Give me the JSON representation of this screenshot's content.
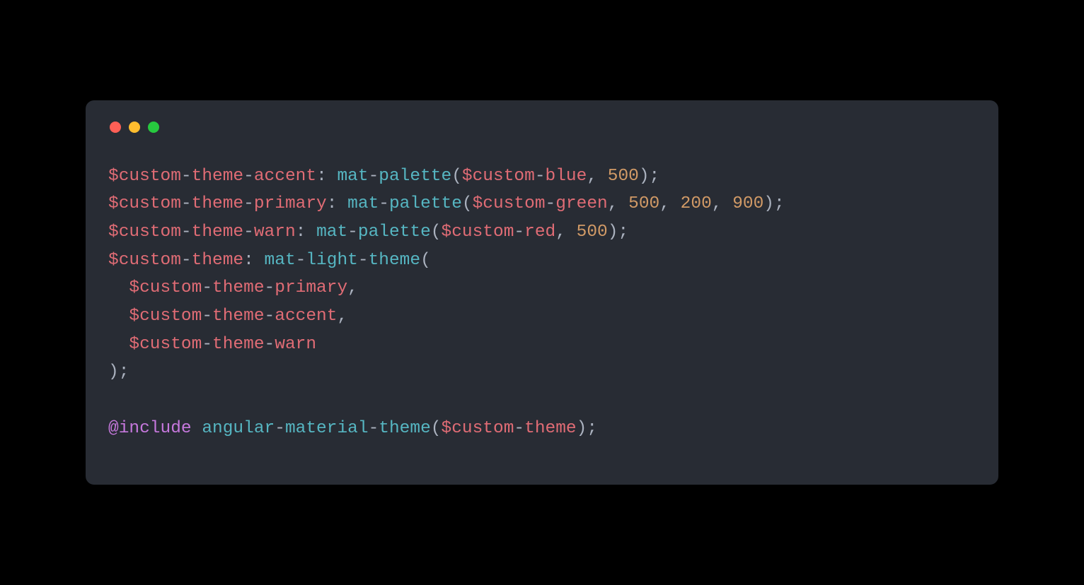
{
  "colors": {
    "traffic_red": "#ff5f56",
    "traffic_yellow": "#ffbd2e",
    "traffic_green": "#27c93f",
    "bg": "#282c34"
  },
  "code": {
    "tokens": [
      [
        {
          "t": "var",
          "v": "$custom"
        },
        {
          "t": "punc",
          "v": "-"
        },
        {
          "t": "var",
          "v": "theme"
        },
        {
          "t": "punc",
          "v": "-"
        },
        {
          "t": "var",
          "v": "accent"
        },
        {
          "t": "punc",
          "v": ": "
        },
        {
          "t": "fn",
          "v": "mat"
        },
        {
          "t": "punc",
          "v": "-"
        },
        {
          "t": "fn",
          "v": "palette"
        },
        {
          "t": "punc",
          "v": "("
        },
        {
          "t": "var",
          "v": "$custom"
        },
        {
          "t": "punc",
          "v": "-"
        },
        {
          "t": "var",
          "v": "blue"
        },
        {
          "t": "punc",
          "v": ", "
        },
        {
          "t": "num",
          "v": "500"
        },
        {
          "t": "punc",
          "v": ");"
        }
      ],
      [
        {
          "t": "var",
          "v": "$custom"
        },
        {
          "t": "punc",
          "v": "-"
        },
        {
          "t": "var",
          "v": "theme"
        },
        {
          "t": "punc",
          "v": "-"
        },
        {
          "t": "var",
          "v": "primary"
        },
        {
          "t": "punc",
          "v": ": "
        },
        {
          "t": "fn",
          "v": "mat"
        },
        {
          "t": "punc",
          "v": "-"
        },
        {
          "t": "fn",
          "v": "palette"
        },
        {
          "t": "punc",
          "v": "("
        },
        {
          "t": "var",
          "v": "$custom"
        },
        {
          "t": "punc",
          "v": "-"
        },
        {
          "t": "var",
          "v": "green"
        },
        {
          "t": "punc",
          "v": ", "
        },
        {
          "t": "num",
          "v": "500"
        },
        {
          "t": "punc",
          "v": ", "
        },
        {
          "t": "num",
          "v": "200"
        },
        {
          "t": "punc",
          "v": ", "
        },
        {
          "t": "num",
          "v": "900"
        },
        {
          "t": "punc",
          "v": ");"
        }
      ],
      [
        {
          "t": "var",
          "v": "$custom"
        },
        {
          "t": "punc",
          "v": "-"
        },
        {
          "t": "var",
          "v": "theme"
        },
        {
          "t": "punc",
          "v": "-"
        },
        {
          "t": "var",
          "v": "warn"
        },
        {
          "t": "punc",
          "v": ": "
        },
        {
          "t": "fn",
          "v": "mat"
        },
        {
          "t": "punc",
          "v": "-"
        },
        {
          "t": "fn",
          "v": "palette"
        },
        {
          "t": "punc",
          "v": "("
        },
        {
          "t": "var",
          "v": "$custom"
        },
        {
          "t": "punc",
          "v": "-"
        },
        {
          "t": "var",
          "v": "red"
        },
        {
          "t": "punc",
          "v": ", "
        },
        {
          "t": "num",
          "v": "500"
        },
        {
          "t": "punc",
          "v": ");"
        }
      ],
      [
        {
          "t": "var",
          "v": "$custom"
        },
        {
          "t": "punc",
          "v": "-"
        },
        {
          "t": "var",
          "v": "theme"
        },
        {
          "t": "punc",
          "v": ": "
        },
        {
          "t": "fn",
          "v": "mat"
        },
        {
          "t": "punc",
          "v": "-"
        },
        {
          "t": "fn",
          "v": "light"
        },
        {
          "t": "punc",
          "v": "-"
        },
        {
          "t": "fn",
          "v": "theme"
        },
        {
          "t": "punc",
          "v": "("
        }
      ],
      [
        {
          "t": "punc",
          "v": "  "
        },
        {
          "t": "var",
          "v": "$custom"
        },
        {
          "t": "punc",
          "v": "-"
        },
        {
          "t": "var",
          "v": "theme"
        },
        {
          "t": "punc",
          "v": "-"
        },
        {
          "t": "var",
          "v": "primary"
        },
        {
          "t": "punc",
          "v": ","
        }
      ],
      [
        {
          "t": "punc",
          "v": "  "
        },
        {
          "t": "var",
          "v": "$custom"
        },
        {
          "t": "punc",
          "v": "-"
        },
        {
          "t": "var",
          "v": "theme"
        },
        {
          "t": "punc",
          "v": "-"
        },
        {
          "t": "var",
          "v": "accent"
        },
        {
          "t": "punc",
          "v": ","
        }
      ],
      [
        {
          "t": "punc",
          "v": "  "
        },
        {
          "t": "var",
          "v": "$custom"
        },
        {
          "t": "punc",
          "v": "-"
        },
        {
          "t": "var",
          "v": "theme"
        },
        {
          "t": "punc",
          "v": "-"
        },
        {
          "t": "var",
          "v": "warn"
        }
      ],
      [
        {
          "t": "punc",
          "v": ");"
        }
      ],
      [],
      [
        {
          "t": "kw",
          "v": "@include"
        },
        {
          "t": "punc",
          "v": " "
        },
        {
          "t": "fn",
          "v": "angular"
        },
        {
          "t": "punc",
          "v": "-"
        },
        {
          "t": "fn",
          "v": "material"
        },
        {
          "t": "punc",
          "v": "-"
        },
        {
          "t": "fn",
          "v": "theme"
        },
        {
          "t": "punc",
          "v": "("
        },
        {
          "t": "var",
          "v": "$custom"
        },
        {
          "t": "punc",
          "v": "-"
        },
        {
          "t": "var",
          "v": "theme"
        },
        {
          "t": "punc",
          "v": ");"
        }
      ]
    ]
  }
}
